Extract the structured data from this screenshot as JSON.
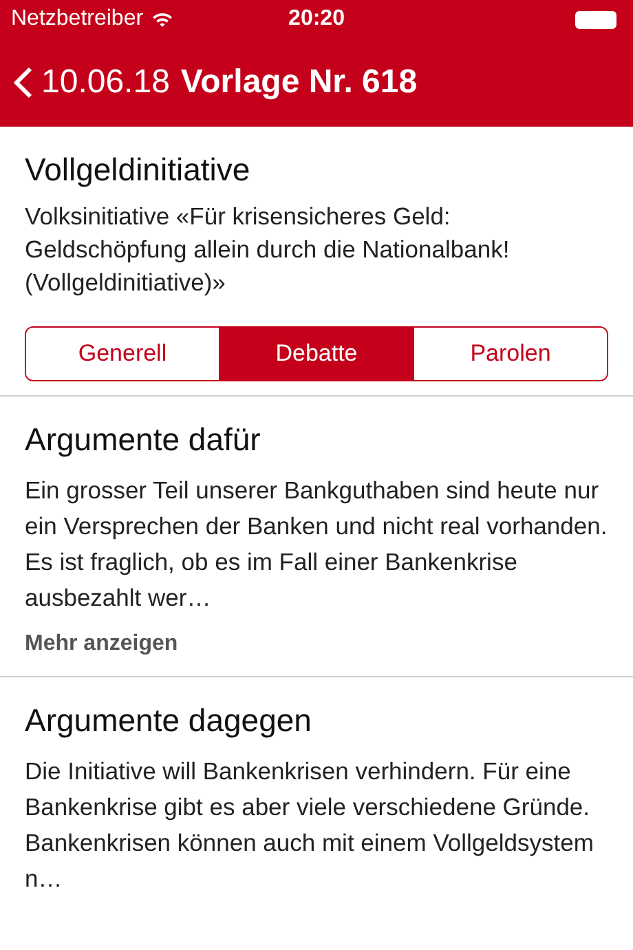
{
  "status_bar": {
    "carrier": "Netzbetreiber",
    "time": "20:20"
  },
  "nav": {
    "back_label": "10.06.18",
    "title": "Vorlage Nr. 618"
  },
  "header": {
    "title": "Vollgeldinitiative",
    "subtitle": "Volksinitiative «Für krisensicheres Geld: Geldschöpfung allein durch die Nationalbank! (Vollgeldinitiative)»"
  },
  "tabs": [
    {
      "label": "Generell",
      "selected": false
    },
    {
      "label": "Debatte",
      "selected": true
    },
    {
      "label": "Parolen",
      "selected": false
    }
  ],
  "sections": [
    {
      "title": "Argumente dafür",
      "text": "Ein grosser Teil unserer Bankguthaben sind heute nur ein Versprechen der Banken und nicht real vorhanden. Es ist fraglich, ob es im Fall einer Bankenkrise ausbezahlt wer…",
      "more": "Mehr anzeigen"
    },
    {
      "title": "Argumente dagegen",
      "text": "Die Initiative will Bankenkrisen verhindern. Für eine Bankenkrise gibt es aber viele verschiedene Gründe. Bankenkrisen können auch mit einem Vollgeldsystem n…"
    }
  ]
}
